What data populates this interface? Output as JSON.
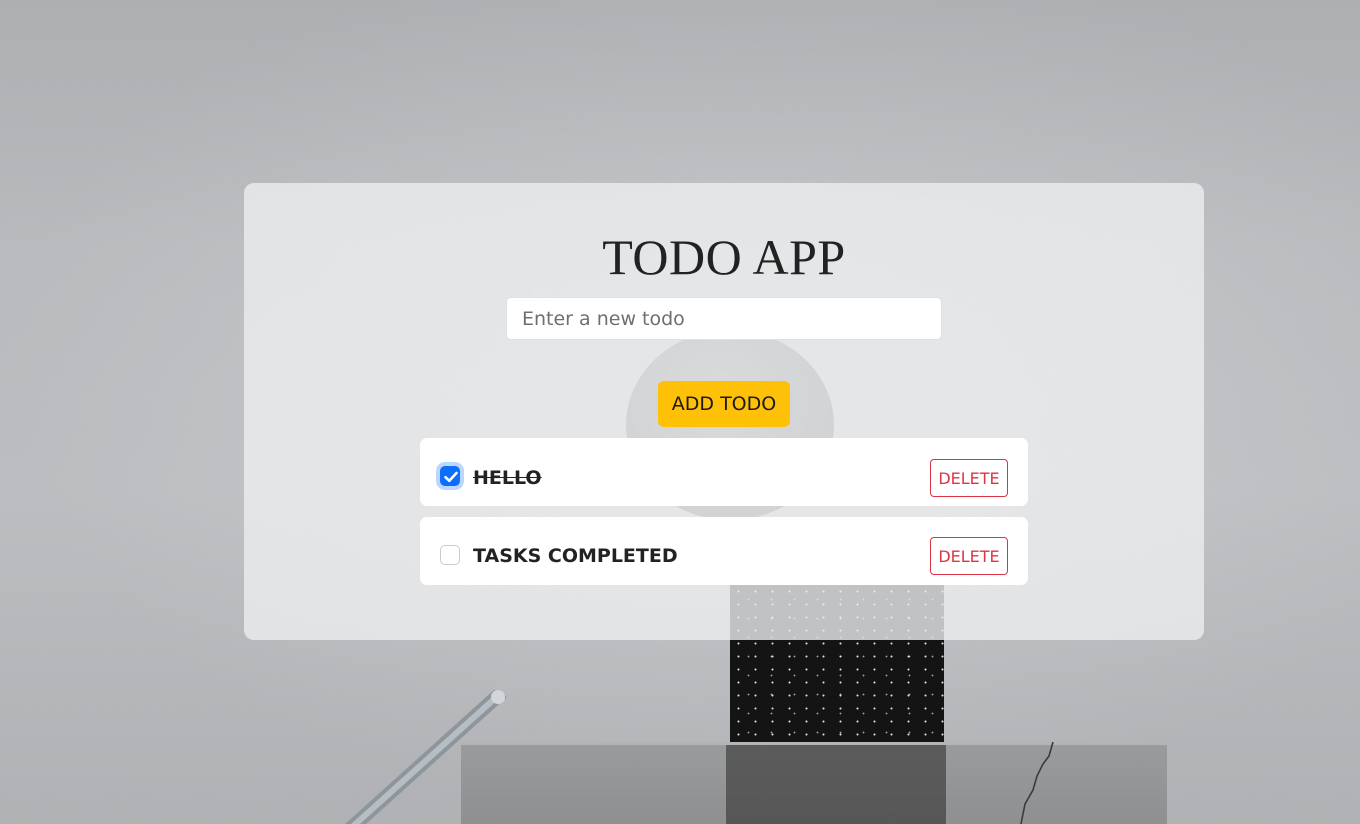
{
  "app": {
    "title": "TODO APP"
  },
  "new_todo": {
    "value": "",
    "placeholder": "Enter a new todo"
  },
  "add_button": {
    "label": "ADD TODO"
  },
  "todos": [
    {
      "text": "HELLO",
      "completed": true,
      "delete_label": "DELETE"
    },
    {
      "text": "TASKS COMPLETED",
      "completed": false,
      "delete_label": "DELETE"
    }
  ],
  "colors": {
    "accent_button": "#ffc107",
    "checkbox_checked": "#0d6efd",
    "delete": "#dc3545"
  },
  "icons": {
    "checkbox_checked": "check-icon"
  }
}
